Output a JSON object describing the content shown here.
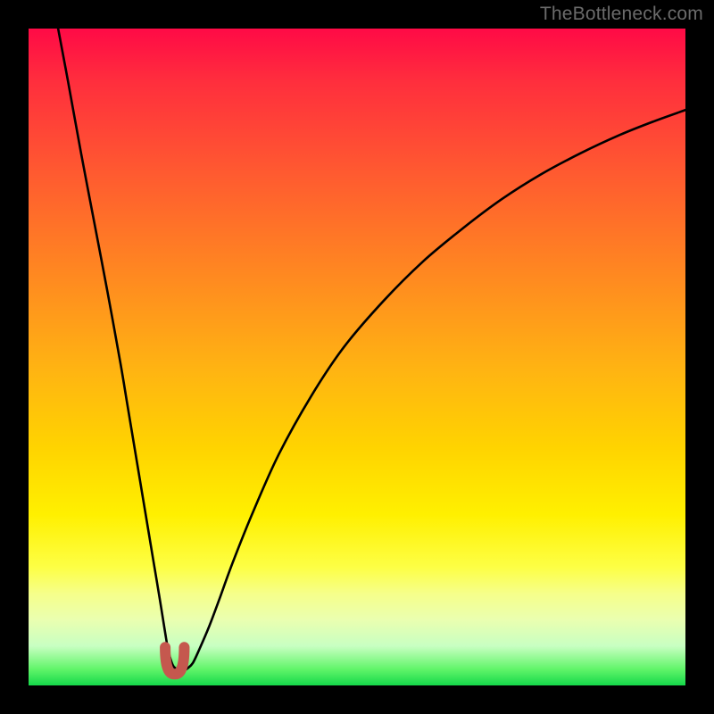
{
  "watermark": {
    "text": "TheBottleneck.com"
  },
  "colors": {
    "frame": "#000000",
    "curve_stroke": "#000000",
    "dip_marker": "#c5584e"
  },
  "chart_data": {
    "type": "line",
    "title": "",
    "xlabel": "",
    "ylabel": "",
    "xlim": [
      0,
      100
    ],
    "ylim": [
      0,
      100
    ],
    "note": "Numeric axes are unlabeled in the original; x is normalized 0–100 across the plot width, y is normalized 0–100 (0 at bottom, 100 at top). Values estimated from pixel positions.",
    "series": [
      {
        "name": "bottleneck-curve",
        "x": [
          4.5,
          6,
          8,
          10,
          12,
          14,
          15,
          16,
          17,
          18,
          19,
          20,
          20.8,
          21.3,
          22,
          22.8,
          23.5,
          24.2,
          25,
          26,
          27.5,
          29,
          31,
          34,
          38,
          43,
          48,
          54,
          60,
          66,
          72,
          78,
          84,
          90,
          95,
          100
        ],
        "values": [
          100,
          92,
          81,
          70.5,
          60,
          49,
          43,
          37,
          31,
          25,
          19,
          13,
          8,
          5.2,
          3,
          2.4,
          2.2,
          2.6,
          3.4,
          5.5,
          9,
          13,
          18.5,
          26,
          35,
          44,
          51.5,
          58.5,
          64.5,
          69.5,
          74,
          77.8,
          81,
          83.8,
          85.8,
          87.6
        ]
      }
    ],
    "dip_marker": {
      "x_range": [
        20.8,
        23.7
      ],
      "y_range": [
        2.0,
        5.8
      ],
      "shape": "U"
    },
    "background_gradient": {
      "direction": "top-to-bottom",
      "stops": [
        {
          "pos": 0.0,
          "color": "#ff0a46"
        },
        {
          "pos": 0.22,
          "color": "#ff5a30"
        },
        {
          "pos": 0.52,
          "color": "#ffb412"
        },
        {
          "pos": 0.74,
          "color": "#fff000"
        },
        {
          "pos": 0.9,
          "color": "#eaffb0"
        },
        {
          "pos": 1.0,
          "color": "#15d84a"
        }
      ]
    }
  }
}
